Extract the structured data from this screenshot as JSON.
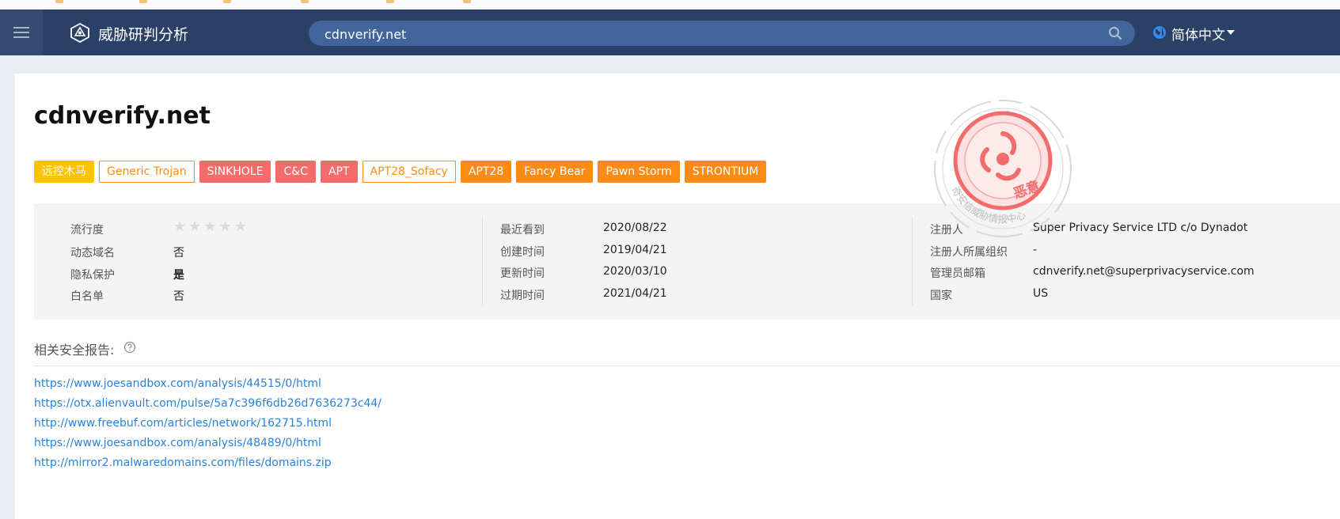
{
  "header": {
    "brand": "威胁研判分析",
    "search_value": "cdnverify.net",
    "language": "简体中文"
  },
  "domain": "cdnverify.net",
  "tags": [
    {
      "label": "远控木马",
      "style": "yellow"
    },
    {
      "label": "Generic Trojan",
      "style": "outline"
    },
    {
      "label": "SINKHOLE",
      "style": "red"
    },
    {
      "label": "C&C",
      "style": "red"
    },
    {
      "label": "APT",
      "style": "red"
    },
    {
      "label": "APT28_Sofacy",
      "style": "outline"
    },
    {
      "label": "APT28",
      "style": "orange"
    },
    {
      "label": "Fancy Bear",
      "style": "orange"
    },
    {
      "label": "Pawn Storm",
      "style": "orange"
    },
    {
      "label": "STRONTIUM",
      "style": "orange"
    }
  ],
  "info": {
    "popularity": {
      "label": "流行度",
      "stars_filled": 0,
      "stars_total": 5
    },
    "dynamic_domain": {
      "label": "动态域名",
      "value": "否"
    },
    "privacy": {
      "label": "隐私保护",
      "value": "是"
    },
    "whitelist": {
      "label": "白名单",
      "value": "否"
    },
    "last_seen": {
      "label": "最近看到",
      "value": "2020/08/22"
    },
    "created": {
      "label": "创建时间",
      "value": "2019/04/21"
    },
    "updated": {
      "label": "更新时间",
      "value": "2020/03/10"
    },
    "expires": {
      "label": "过期时间",
      "value": "2021/04/21"
    },
    "registrant": {
      "label": "注册人",
      "value": "Super Privacy Service LTD c/o Dynadot"
    },
    "registrant_org": {
      "label": "注册人所属组织",
      "value": "-"
    },
    "admin_email": {
      "label": "管理员邮箱",
      "value": "cdnverify.net@superprivacyservice.com"
    },
    "country": {
      "label": "国家",
      "value": "US"
    }
  },
  "stamp": {
    "verdict": "恶意",
    "issuer": "奇安信威胁情报中心"
  },
  "reports": {
    "title": "相关安全报告:",
    "links": [
      "https://www.joesandbox.com/analysis/44515/0/html",
      "https://otx.alienvault.com/pulse/5a7c396f6db26d7636273c44/",
      "http://www.freebuf.com/articles/network/162715.html",
      "https://www.joesandbox.com/analysis/48489/0/html",
      "http://mirror2.malwaredomains.com/files/domains.zip"
    ]
  },
  "colors": {
    "header_bg": "#2b4066",
    "search_bg": "#41649b",
    "tag_yellow": "#ffc200",
    "tag_red": "#f36c6c",
    "tag_orange": "#fa8c16",
    "link": "#2b82d9",
    "stamp_red": "#f36c6c"
  },
  "icons": [
    "menu-icon",
    "brand-logo-icon",
    "search-icon",
    "globe-icon",
    "caret-down-icon",
    "star-icon",
    "help-icon"
  ]
}
